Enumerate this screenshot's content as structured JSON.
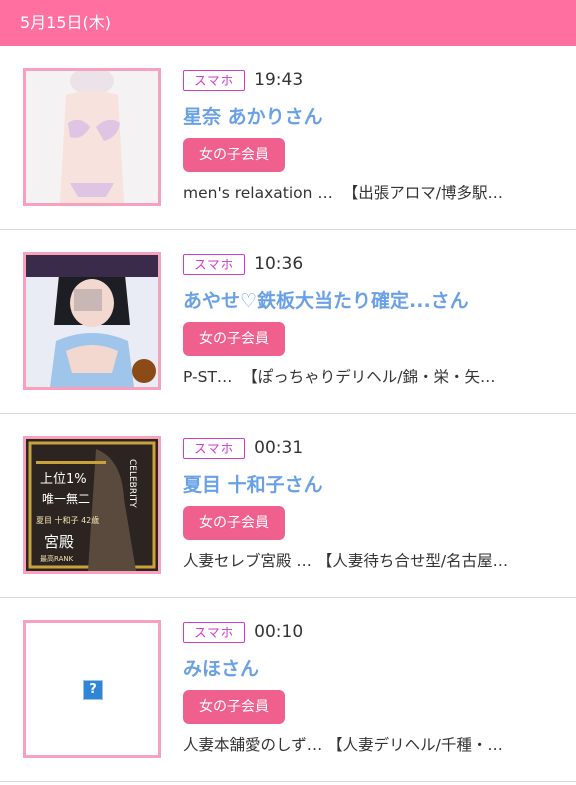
{
  "date_header": "5月15日(木)",
  "device_tag": "スマホ",
  "member_badge": "女の子会員",
  "colors": {
    "header_bg": "#ff6f9f",
    "name": "#6aa1e6",
    "badge_bg": "#f0608f",
    "tag": "#d23ad0",
    "thumb_border": "#f7a1bd"
  },
  "items": [
    {
      "time": "19:43",
      "name": "星奈 あかりさん",
      "shop": "men's relaxation …  【出張アロマ/博多駅…"
    },
    {
      "time": "10:36",
      "name": "あやせ♡鉄板大当たり確定...さん",
      "shop": "P-ST…  【ぽっちゃりデリヘル/錦・栄・矢…"
    },
    {
      "time": "00:31",
      "name": "夏目 十和子さん",
      "shop": "人妻セレブ宮殿 … 【人妻待ち合せ型/名古屋…",
      "thumb_text": {
        "rank": "上位1%",
        "unique": "唯一無二",
        "person": "夏目 十和子 42歳",
        "palace": "宮殿",
        "rank_label": "最高RANK",
        "celebrity": "CELEBRITY"
      }
    },
    {
      "time": "00:10",
      "name": "みほさん",
      "shop": "人妻本舗愛のしず… 【人妻デリヘル/千種・…",
      "thumb_placeholder": "?"
    }
  ]
}
